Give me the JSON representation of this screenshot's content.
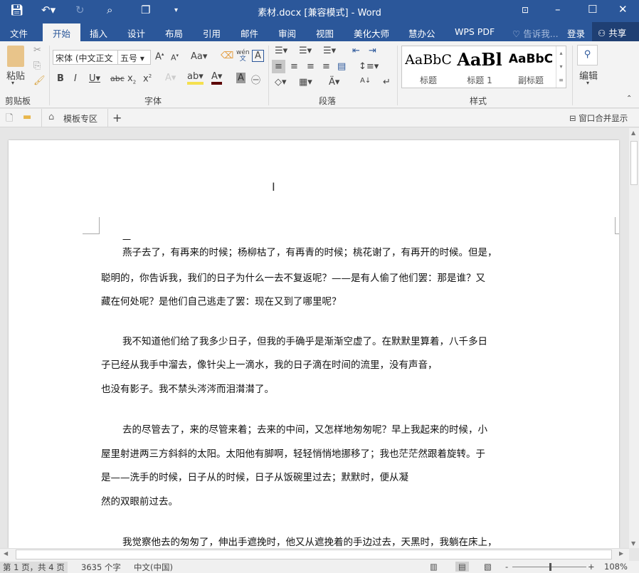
{
  "window": {
    "title": "素材.docx [兼容模式] - Word"
  },
  "tabs": [
    "文件",
    "开始",
    "插入",
    "设计",
    "布局",
    "引用",
    "邮件",
    "审阅",
    "视图",
    "美化大师",
    "慧办公",
    "WPS PDF"
  ],
  "tell_me": "告诉我...",
  "login": "登录",
  "share": "共享",
  "ribbon": {
    "paste": "粘贴",
    "font_name": "宋体 (中文正文",
    "font_size": "五号",
    "groups": {
      "clipboard": "剪贴板",
      "font": "字体",
      "paragraph": "段落",
      "styles": "样式"
    },
    "styles": [
      {
        "sample": "AaBbC",
        "label": "标题"
      },
      {
        "sample": "AaBl",
        "label": "标题 1"
      },
      {
        "sample": "AaBbC",
        "label": "副标题"
      }
    ],
    "edit": "编辑",
    "wen": "wén",
    "wen2": "文"
  },
  "tabbar": {
    "template": "模板专区",
    "merge": "窗口合并显示"
  },
  "document": {
    "lines": [
      {
        "text": "一",
        "indent": false
      },
      {
        "text": "燕子去了，有再来的时候；杨柳枯了，有再青的时候；桃花谢了，有再开的时候。但是，",
        "indent": true
      },
      {
        "text": "聪明的，你告诉我，我们的日子为什么一去不复返呢？——是有人偷了他们罢：那是谁？又",
        "indent": false
      },
      {
        "text": "藏在何处呢？是他们自己逃走了罢：现在又到了哪里呢？",
        "indent": false
      },
      {
        "text": "我不知道他们给了我多少日子，但我的手确乎是渐渐空虚了。在默默里算着，八千多日",
        "indent": true
      },
      {
        "text": "子已经从我手中溜去，像针尖上一滴水，我的日子滴在时间的流里，没有声音，",
        "indent": false
      },
      {
        "text": "也没有影子。我不禁头涔涔而泪潸潸了。",
        "indent": false
      },
      {
        "text": "去的尽管去了，来的尽管来着；去来的中间，又怎样地匆匆呢？早上我起来的时候，小",
        "indent": true
      },
      {
        "text": "屋里射进两三方斜斜的太阳。太阳他有脚啊，轻轻悄悄地挪移了；我也茫茫然跟着旋转。于",
        "indent": false
      },
      {
        "text": "是——洗手的时候，日子从的时候，日子从饭碗里过去；默默时，便从凝",
        "indent": false
      },
      {
        "text": "然的双眼前过去。",
        "indent": false
      },
      {
        "text": "我觉察他去的匆匆了，伸出手遮挽时，他又从遮挽着的手边过去，天黑时，我躺在床上，",
        "indent": true
      }
    ]
  },
  "status": {
    "page": "第 1 页，共 4 页",
    "words": "3635 个字",
    "lang": "中文(中国)",
    "zoom": "108%",
    "zoom_value": 108
  }
}
